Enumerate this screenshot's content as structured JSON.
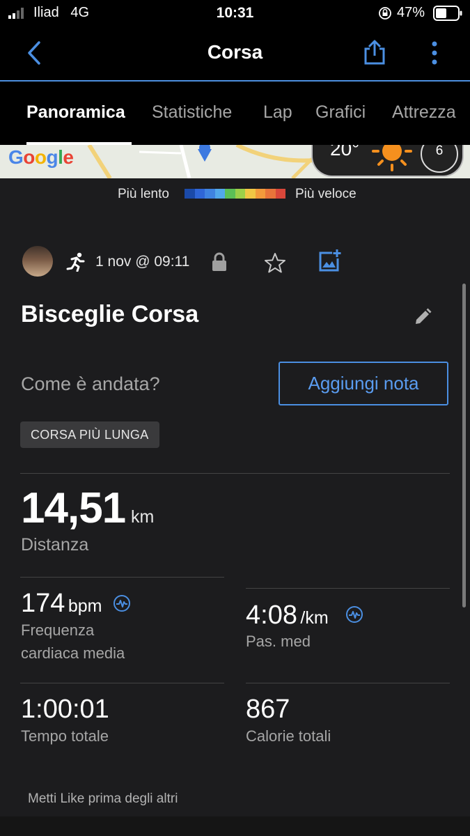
{
  "status_bar": {
    "carrier": "Iliad",
    "network": "4G",
    "time": "10:31",
    "battery": "47%"
  },
  "nav": {
    "title": "Corsa",
    "back_icon": "back-chevron-icon",
    "share_icon": "share-icon",
    "more_icon": "more-vertical-icon"
  },
  "tabs": [
    {
      "label": "Panoramica",
      "active": true
    },
    {
      "label": "Statistiche",
      "active": false
    },
    {
      "label": "Lap",
      "active": false
    },
    {
      "label": "Grafici",
      "active": false
    },
    {
      "label": "Attrezza",
      "active": false
    }
  ],
  "map": {
    "google_logo": "Google",
    "temperature": "20°",
    "wind_speed": "6"
  },
  "legend": {
    "slow_label": "Più lento",
    "fast_label": "Più veloce",
    "colors": [
      "#1b4aa8",
      "#2f66d6",
      "#3f83e0",
      "#52a8ea",
      "#5bbf56",
      "#9ccf49",
      "#f0c644",
      "#f29a3b",
      "#e8743a",
      "#d9473a"
    ]
  },
  "activity": {
    "date": "1 nov @ 09:11",
    "name": "Bisceglie Corsa",
    "prompt": "Come è andata?",
    "add_note_label": "Aggiungi nota",
    "badge": "CORSA PIÙ LUNGA"
  },
  "stats": {
    "distance": {
      "value": "14,51",
      "unit": "km",
      "label": "Distanza"
    },
    "heart_rate": {
      "value": "174",
      "unit": "bpm",
      "label_line1": "Frequenza",
      "label_line2": "cardiaca media"
    },
    "pace": {
      "value": "4:08",
      "unit": "/km",
      "label": "Pas. med"
    },
    "time": {
      "value": "1:00:01",
      "label": "Tempo totale"
    },
    "calories": {
      "value": "867",
      "label": "Calorie totali"
    }
  },
  "footer": {
    "like_prompt": "Metti Like prima degli altri"
  },
  "colors": {
    "accent": "#4b8fe2",
    "background": "#1c1c1e",
    "secondary_text": "#a6a6a6"
  }
}
